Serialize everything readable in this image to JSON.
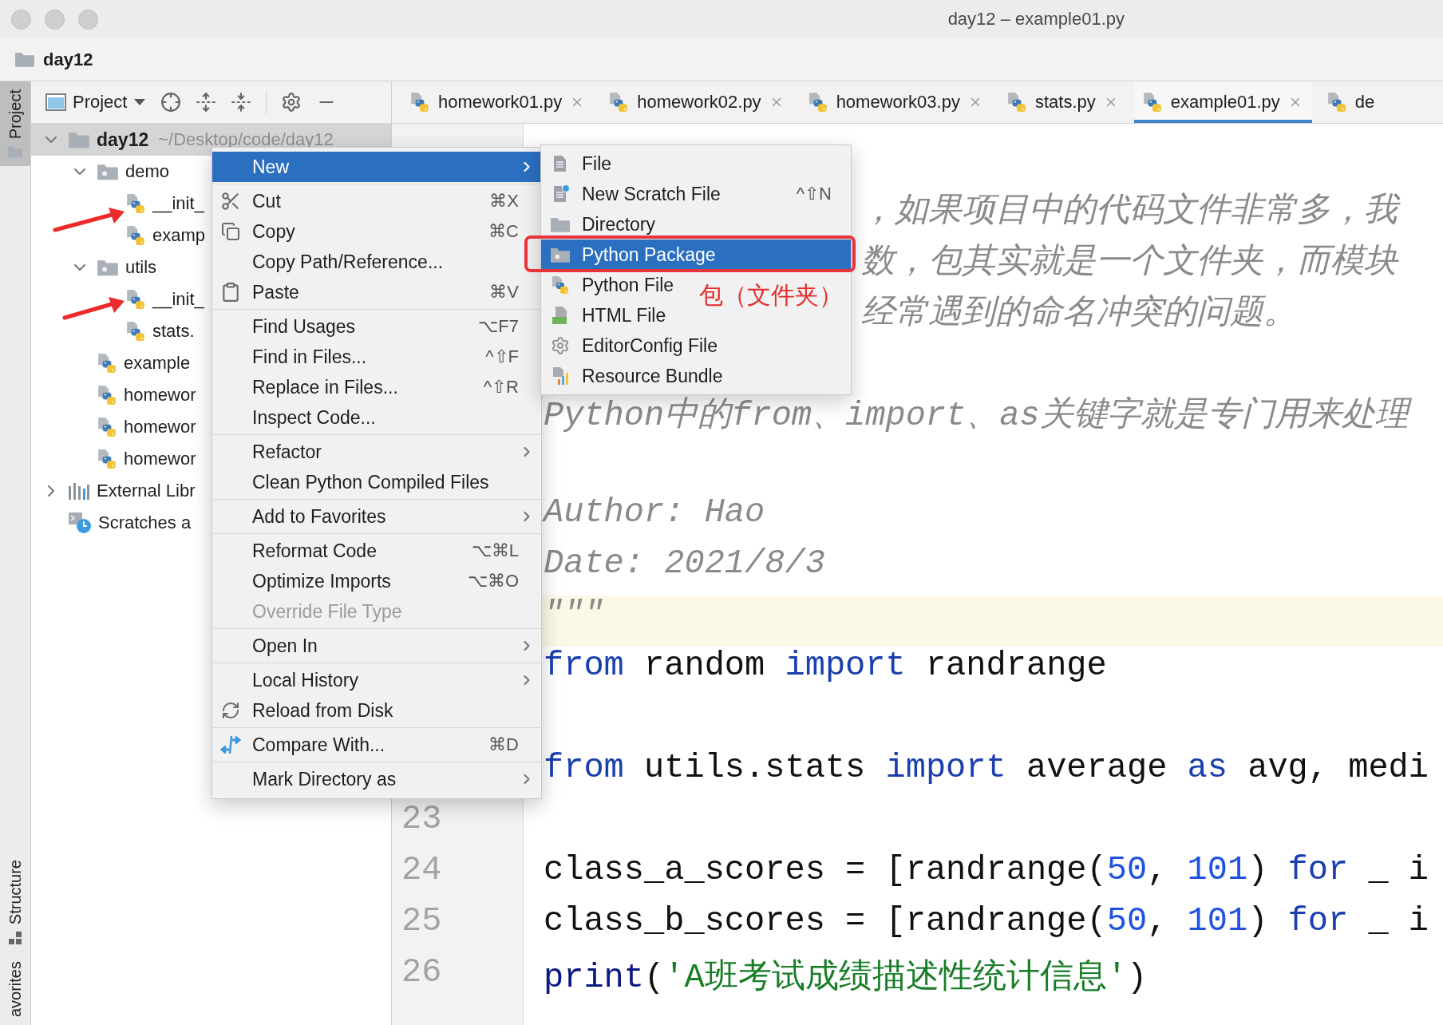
{
  "window": {
    "title": "day12 – example01.py"
  },
  "breadcrumb": {
    "label": "day12"
  },
  "tool_stripe": [
    {
      "label": "Project",
      "selected": true
    },
    {
      "label": "Structure",
      "selected": false
    },
    {
      "label": "avorites",
      "selected": false
    }
  ],
  "project_panel": {
    "view": "Project",
    "tree": [
      {
        "label": "day12",
        "hint": "~/Desktop/code/day12",
        "kind": "folder",
        "expanded": true,
        "selected": true,
        "children": [
          {
            "label": "demo",
            "kind": "package",
            "expanded": true,
            "selected": false,
            "children": [
              {
                "label": "__init_",
                "kind": "python",
                "selected": false
              },
              {
                "label": "examp",
                "kind": "python",
                "selected": false
              }
            ]
          },
          {
            "label": "utils",
            "kind": "package",
            "expanded": true,
            "selected": false,
            "children": [
              {
                "label": "__init_",
                "kind": "python",
                "selected": false
              },
              {
                "label": "stats.",
                "kind": "python",
                "selected": false
              }
            ]
          },
          {
            "label": "example",
            "kind": "python",
            "selected": false
          },
          {
            "label": "homewor",
            "kind": "python",
            "selected": false
          },
          {
            "label": "homewor",
            "kind": "python",
            "selected": false
          },
          {
            "label": "homewor",
            "kind": "python",
            "selected": false
          }
        ]
      },
      {
        "label": "External Libr",
        "kind": "library",
        "expanded": false,
        "selected": false
      },
      {
        "label": "Scratches a",
        "kind": "scratch",
        "selected": false
      }
    ]
  },
  "editor_tabs": [
    {
      "label": "homework01.py",
      "selected": false,
      "closable": true
    },
    {
      "label": "homework02.py",
      "selected": false,
      "closable": true
    },
    {
      "label": "homework03.py",
      "selected": false,
      "closable": true
    },
    {
      "label": "stats.py",
      "selected": false,
      "closable": true
    },
    {
      "label": "example01.py",
      "selected": true,
      "closable": true
    },
    {
      "label": "de",
      "selected": false,
      "closable": false
    }
  ],
  "editor": {
    "lines": [
      {
        "kind": "covered",
        "current": false,
        "tokens": [
          {
            "kind": "doc",
            "text": "，如果项目中的代码文件非常多，我"
          }
        ]
      },
      {
        "kind": "covered",
        "current": false,
        "tokens": [
          {
            "kind": "doc",
            "text": "数，包其实就是一个文件夹，而模块"
          }
        ]
      },
      {
        "kind": "covered",
        "current": false,
        "tokens": [
          {
            "kind": "doc",
            "text": "经常遇到的命名冲突的问题。"
          }
        ]
      },
      {
        "kind": "blank",
        "current": false
      },
      {
        "kind": "code",
        "current": false,
        "tokens": [
          {
            "kind": "doc",
            "text": "Python中的from、import、as关键字就是专门用来处理"
          }
        ]
      },
      {
        "kind": "blank",
        "current": false
      },
      {
        "kind": "code",
        "current": false,
        "tokens": [
          {
            "kind": "doc",
            "text": "Author: Hao"
          }
        ]
      },
      {
        "kind": "code",
        "current": false,
        "tokens": [
          {
            "kind": "doc",
            "text": "Date: 2021/8/3"
          }
        ]
      },
      {
        "kind": "code",
        "current": true,
        "tokens": [
          {
            "kind": "doc",
            "text": "\"\"\""
          }
        ]
      },
      {
        "kind": "code",
        "current": false,
        "tokens": [
          {
            "kind": "kw",
            "text": "from"
          },
          {
            "kind": "plain",
            "text": " random "
          },
          {
            "kind": "kw",
            "text": "import"
          },
          {
            "kind": "plain",
            "text": " randrange"
          }
        ]
      },
      {
        "kind": "blank",
        "current": false
      },
      {
        "kind": "code",
        "current": false,
        "tokens": [
          {
            "kind": "kw",
            "text": "from"
          },
          {
            "kind": "plain",
            "text": " utils.stats "
          },
          {
            "kind": "kw",
            "text": "import"
          },
          {
            "kind": "plain",
            "text": " average "
          },
          {
            "kind": "kw",
            "text": "as"
          },
          {
            "kind": "plain",
            "text": " avg, medi"
          }
        ]
      },
      {
        "kind": "blank",
        "number": "23",
        "current": false
      },
      {
        "kind": "code",
        "number": "24",
        "current": false,
        "tokens": [
          {
            "kind": "plain",
            "text": "class_a_scores = [randrange("
          },
          {
            "kind": "num",
            "text": "50"
          },
          {
            "kind": "plain",
            "text": ", "
          },
          {
            "kind": "num",
            "text": "101"
          },
          {
            "kind": "plain",
            "text": ") "
          },
          {
            "kind": "kw",
            "text": "for"
          },
          {
            "kind": "plain",
            "text": " _ i"
          }
        ]
      },
      {
        "kind": "code",
        "number": "25",
        "current": false,
        "tokens": [
          {
            "kind": "plain",
            "text": "class_b_scores = [randrange("
          },
          {
            "kind": "num",
            "text": "50"
          },
          {
            "kind": "plain",
            "text": ", "
          },
          {
            "kind": "num",
            "text": "101"
          },
          {
            "kind": "plain",
            "text": ") "
          },
          {
            "kind": "kw",
            "text": "for"
          },
          {
            "kind": "plain",
            "text": " _ i"
          }
        ]
      },
      {
        "kind": "code",
        "number": "26",
        "current": false,
        "tokens": [
          {
            "kind": "call",
            "text": "print"
          },
          {
            "kind": "plain",
            "text": "("
          },
          {
            "kind": "str",
            "text": "'A班考试成绩描述性统计信息'"
          },
          {
            "kind": "plain",
            "text": ")"
          }
        ]
      }
    ]
  },
  "context_menu": {
    "groups": [
      [
        {
          "label": "New",
          "kind": "plain",
          "submenu": true,
          "selected": true,
          "disabled": false
        }
      ],
      [
        {
          "label": "Cut",
          "shortcut": "⌘X",
          "kind": "scissors",
          "submenu": false,
          "selected": false,
          "disabled": false
        },
        {
          "label": "Copy",
          "shortcut": "⌘C",
          "kind": "copy",
          "submenu": false,
          "selected": false,
          "disabled": false
        },
        {
          "label": "Copy Path/Reference...",
          "kind": "plain",
          "submenu": false,
          "selected": false,
          "disabled": false
        },
        {
          "label": "Paste",
          "shortcut": "⌘V",
          "kind": "clipboard",
          "submenu": false,
          "selected": false,
          "disabled": false
        }
      ],
      [
        {
          "label": "Find Usages",
          "shortcut": "⌥F7",
          "kind": "plain",
          "submenu": false,
          "selected": false,
          "disabled": false
        },
        {
          "label": "Find in Files...",
          "shortcut": "^⇧F",
          "kind": "plain",
          "submenu": false,
          "selected": false,
          "disabled": false
        },
        {
          "label": "Replace in Files...",
          "shortcut": "^⇧R",
          "kind": "plain",
          "submenu": false,
          "selected": false,
          "disabled": false
        },
        {
          "label": "Inspect Code...",
          "kind": "plain",
          "submenu": false,
          "selected": false,
          "disabled": false
        }
      ],
      [
        {
          "label": "Refactor",
          "kind": "plain",
          "submenu": true,
          "selected": false,
          "disabled": false
        },
        {
          "label": "Clean Python Compiled Files",
          "kind": "plain",
          "submenu": false,
          "selected": false,
          "disabled": false
        }
      ],
      [
        {
          "label": "Add to Favorites",
          "kind": "plain",
          "submenu": true,
          "selected": false,
          "disabled": false
        }
      ],
      [
        {
          "label": "Reformat Code",
          "shortcut": "⌥⌘L",
          "kind": "plain",
          "submenu": false,
          "selected": false,
          "disabled": false
        },
        {
          "label": "Optimize Imports",
          "shortcut": "⌥⌘O",
          "kind": "plain",
          "submenu": false,
          "selected": false,
          "disabled": false
        },
        {
          "label": "Override File Type",
          "kind": "plain",
          "submenu": false,
          "selected": false,
          "disabled": true
        }
      ],
      [
        {
          "label": "Open In",
          "kind": "plain",
          "submenu": true,
          "selected": false,
          "disabled": false
        }
      ],
      [
        {
          "label": "Local History",
          "kind": "plain",
          "submenu": true,
          "selected": false,
          "disabled": false
        },
        {
          "label": "Reload from Disk",
          "kind": "reload",
          "submenu": false,
          "selected": false,
          "disabled": false
        }
      ],
      [
        {
          "label": "Compare With...",
          "shortcut": "⌘D",
          "kind": "compare",
          "submenu": false,
          "selected": false,
          "disabled": false
        }
      ],
      [
        {
          "label": "Mark Directory as",
          "kind": "plain",
          "submenu": true,
          "selected": false,
          "disabled": false
        }
      ]
    ]
  },
  "submenu": {
    "items": [
      {
        "label": "File",
        "kind": "text-file",
        "selected": false
      },
      {
        "label": "New Scratch File",
        "shortcut": "^⇧N",
        "kind": "scratch",
        "selected": false
      },
      {
        "label": "Directory",
        "kind": "folder",
        "selected": false
      },
      {
        "label": "Python Package",
        "kind": "package",
        "selected": true
      },
      {
        "label": "Python File",
        "kind": "python",
        "selected": false
      },
      {
        "label": "HTML File",
        "kind": "html",
        "selected": false
      },
      {
        "label": "EditorConfig File",
        "kind": "gear",
        "selected": false
      },
      {
        "label": "Resource Bundle",
        "kind": "bundle",
        "selected": false
      }
    ]
  },
  "annotation": {
    "label": "包（文件夹）"
  }
}
